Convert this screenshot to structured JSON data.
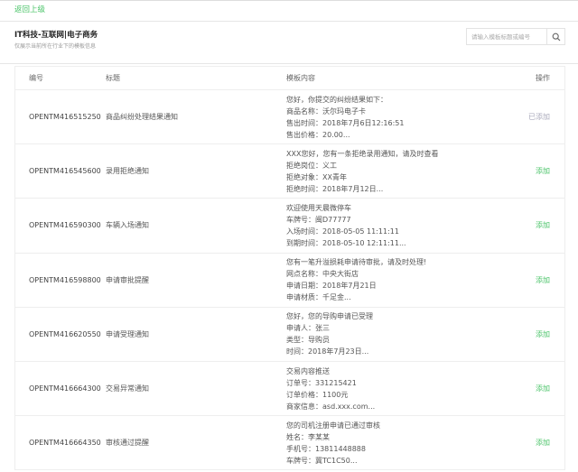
{
  "nav": {
    "back_label": "返回上级"
  },
  "header": {
    "title": "IT科技-互联网|电子商务",
    "subtitle": "仅展示当前所在行业下的模板信息"
  },
  "search": {
    "placeholder": "请输入模板标题或编号",
    "icon": "search-icon"
  },
  "table": {
    "columns": [
      "编号",
      "标题",
      "模板内容",
      "操作"
    ],
    "rows": [
      {
        "id": "OPENTM416515250",
        "title": "商品纠纷处理结果通知",
        "content": [
          "您好，你提交的纠纷结果如下：",
          "商品名称：沃尔玛电子卡",
          "售出时间：2018年7月6日12:16:51",
          "售出价格：20.00..."
        ],
        "action": "已添加",
        "added": true
      },
      {
        "id": "OPENTM416545600",
        "title": "录用拒绝通知",
        "content": [
          "XXX您好，您有一条拒绝录用通知，请及时查看",
          "拒绝岗位：义工",
          "拒绝对象：XX青年",
          "拒绝时间：2018年7月12日..."
        ],
        "action": "添加",
        "added": false
      },
      {
        "id": "OPENTM416590300",
        "title": "车辆入场通知",
        "content": [
          "欢迎使用天晨微停车",
          "车牌号：闽D77777",
          "入场时间：2018-05-05 11:11:11",
          "到期时间：2018-05-10 12:11:11..."
        ],
        "action": "添加",
        "added": false
      },
      {
        "id": "OPENTM416598800",
        "title": "申请审批提醒",
        "content": [
          "您有一笔升溢损耗申请待审批，请及时处理!",
          "网点名称：中央大街店",
          "申请日期：2018年7月21日",
          "申请材质：千足金..."
        ],
        "action": "添加",
        "added": false
      },
      {
        "id": "OPENTM416620550",
        "title": "申请受理通知",
        "content": [
          "您好，您的导购申请已受理",
          "申请人：张三",
          "类型：导购员",
          "时间：2018年7月23日..."
        ],
        "action": "添加",
        "added": false
      },
      {
        "id": "OPENTM416664300",
        "title": "交易异常通知",
        "content": [
          "交易内容推送",
          "订单号：331215421",
          "订单价格：1100元",
          "商家信息：asd.xxx.com..."
        ],
        "action": "添加",
        "added": false
      },
      {
        "id": "OPENTM416664350",
        "title": "审核通过提醒",
        "content": [
          "您的司机注册申请已通过审核",
          "姓名：李某某",
          "手机号：13811448888",
          "车牌号：冀TC1C50..."
        ],
        "action": "添加",
        "added": false
      }
    ]
  },
  "colors": {
    "accent": "#4cc46a"
  }
}
